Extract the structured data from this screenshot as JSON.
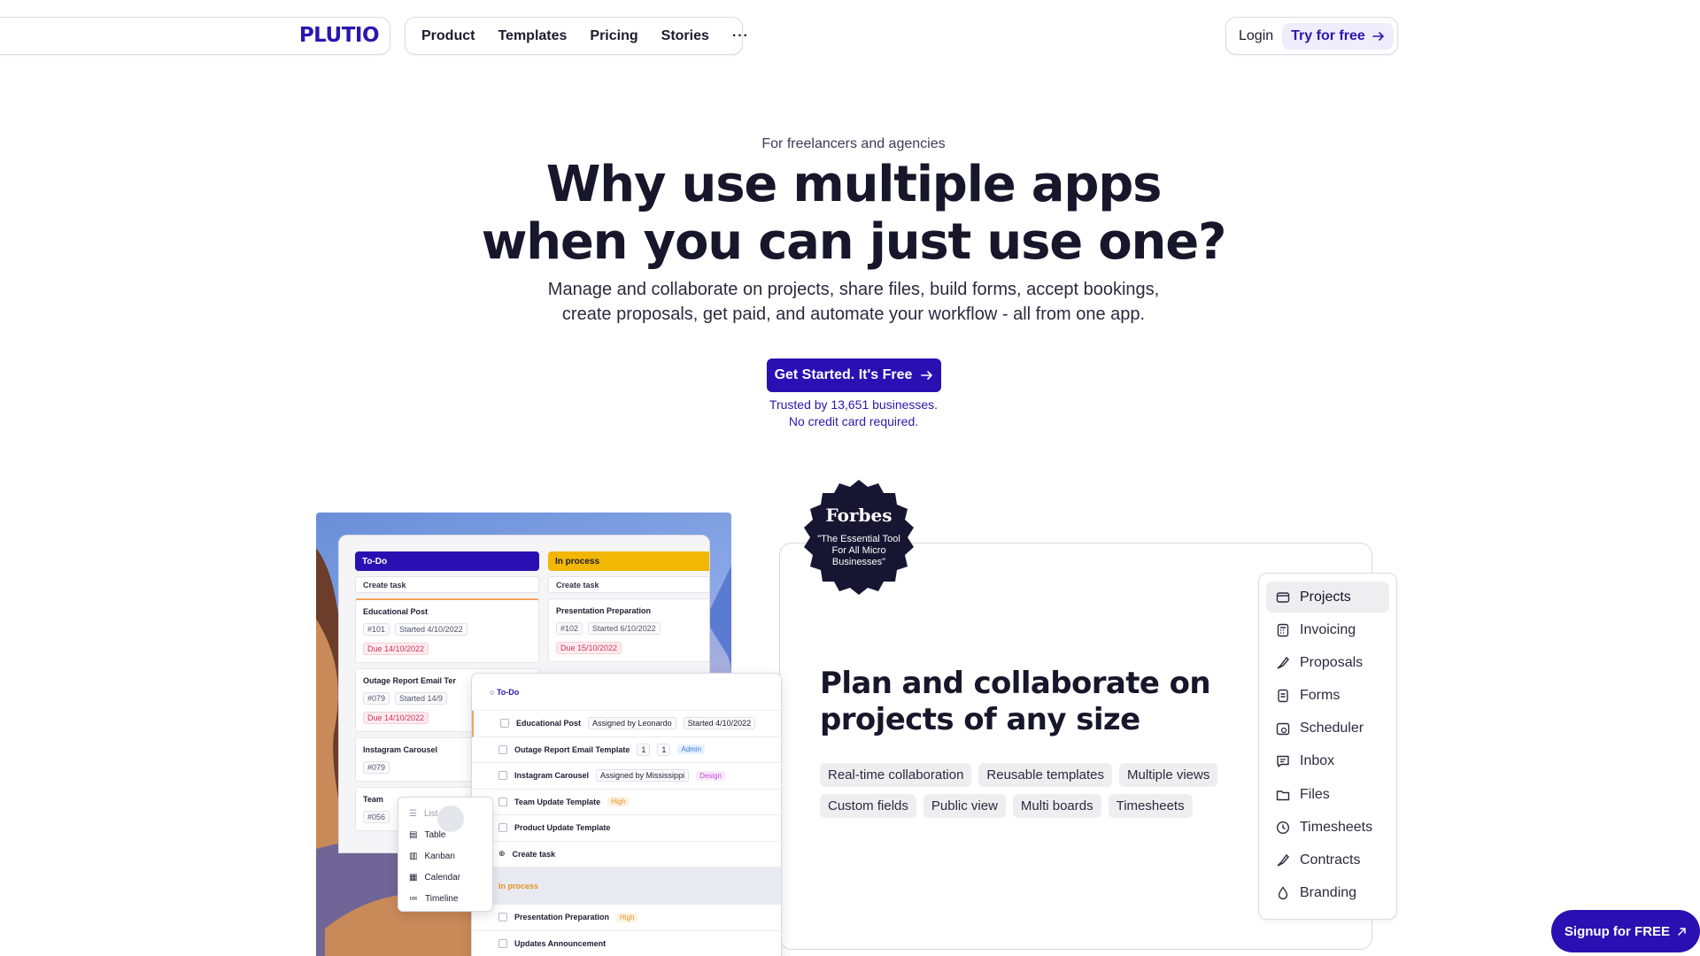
{
  "nav": {
    "logo": "PLUTIO",
    "links": [
      "Product",
      "Templates",
      "Pricing",
      "Stories"
    ],
    "more": "···",
    "login": "Login",
    "try": "Try for free"
  },
  "hero": {
    "eyebrow": "For freelancers and agencies",
    "title_line1": "Why use multiple apps",
    "title_line2": "when you can just use one?",
    "sub_line1": "Manage and collaborate on projects, share files, build forms, accept bookings,",
    "sub_line2": "create proposals, get paid, and automate your workflow - all from one app.",
    "cta": "Get Started. It's Free",
    "trust_line1": "Trusted by 13,651 businesses.",
    "trust_line2": "No credit card required."
  },
  "forbes": {
    "name": "Forbes",
    "quote": "\"The Essential Tool For All Micro Businesses\""
  },
  "feature": {
    "title": "Plan and collaborate on projects of any size",
    "tags": [
      "Real-time collaboration",
      "Reusable templates",
      "Multiple views",
      "Custom fields",
      "Public view",
      "Multi boards",
      "Timesheets"
    ]
  },
  "side_menu": {
    "items": [
      "Projects",
      "Invoicing",
      "Proposals",
      "Forms",
      "Scheduler",
      "Inbox",
      "Files",
      "Timesheets",
      "Contracts",
      "Branding"
    ]
  },
  "signup": "Signup for FREE",
  "mock": {
    "todo": "To-Do",
    "in_process": "In process",
    "create_task": "Create task",
    "card1": {
      "title": "Educational Post",
      "id": "#101",
      "started": "Started 4/10/2022",
      "due": "Due 14/10/2022"
    },
    "card2": {
      "title": "Outage Report Email Ter",
      "id": "#079",
      "started": "Started 14/9",
      "due": "Due 14/10/2022"
    },
    "card3": {
      "title": "Instagram Carousel",
      "id": "#079"
    },
    "card4": {
      "title": "Team",
      "id": "#056"
    },
    "card5": {
      "title": "Presentation Preparation",
      "id": "#102",
      "started": "Started 6/10/2022",
      "due": "Due 15/10/2022"
    },
    "list_head": "To-Do",
    "rows": [
      {
        "title": "Educational Post",
        "assigned": "Assigned by Leonardo",
        "started": "Started 4/10/2022"
      },
      {
        "title": "Outage Report Email Template",
        "c1": "1",
        "c2": "1",
        "label": "Admin"
      },
      {
        "title": "Instagram Carousel",
        "assigned": "Assigned by Mississippi",
        "label": "Design"
      },
      {
        "title": "Team Update Template",
        "label": "High"
      },
      {
        "title": "Product Update Template"
      },
      {
        "title": "Create task"
      }
    ],
    "section2": "In process",
    "rows2": [
      {
        "title": "Presentation Preparation",
        "label": "High"
      },
      {
        "title": "Updates Announcement"
      }
    ],
    "views": [
      "List",
      "Table",
      "Kanban",
      "Calendar",
      "Timeline"
    ]
  },
  "colors": {
    "brand": "#2a10b3",
    "todo_header": "#2a10b3",
    "in_process_header": "#f2b705"
  }
}
